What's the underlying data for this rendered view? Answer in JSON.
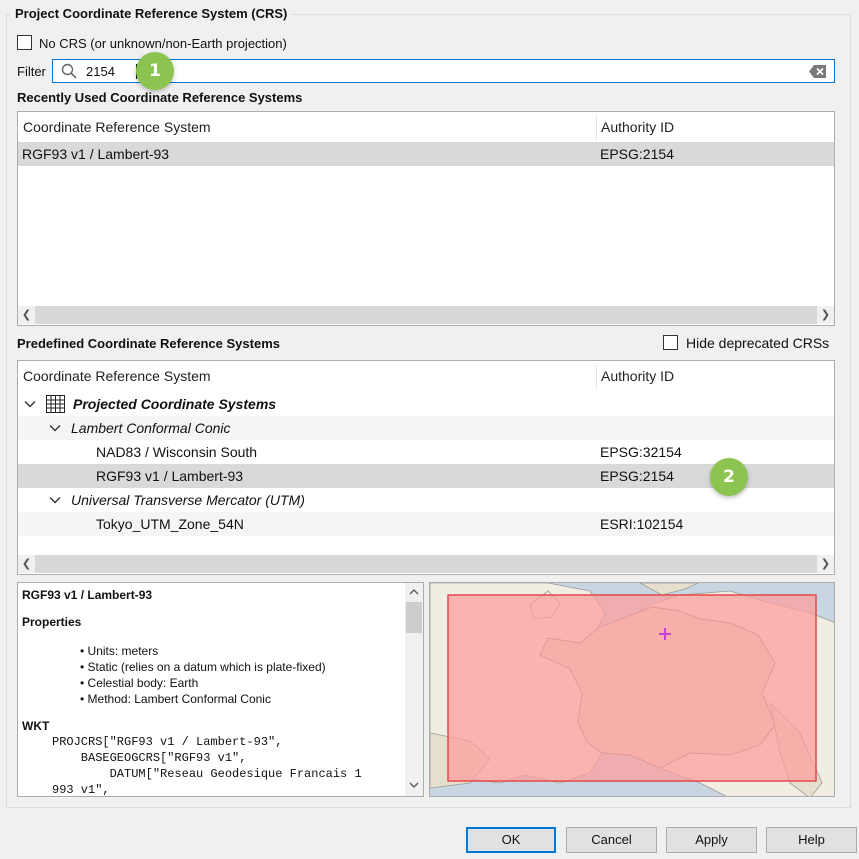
{
  "group": {
    "title": "Project Coordinate Reference System (CRS)"
  },
  "no_crs": {
    "label": "No CRS (or unknown/non-Earth projection)",
    "checked": false
  },
  "filter": {
    "label": "Filter",
    "value": "2154"
  },
  "recent": {
    "title": "Recently Used Coordinate Reference Systems",
    "columns": [
      "Coordinate Reference System",
      "Authority ID"
    ],
    "rows": [
      {
        "name": "RGF93 v1 / Lambert-93",
        "auth": "EPSG:2154",
        "selected": true
      }
    ]
  },
  "predefined": {
    "title": "Predefined Coordinate Reference Systems",
    "hide_deprecated": {
      "label": "Hide deprecated CRSs",
      "checked": false
    },
    "columns": [
      "Coordinate Reference System",
      "Authority ID"
    ],
    "group": "Projected Coordinate Systems",
    "subgroups": [
      {
        "name": "Lambert Conformal Conic",
        "items": [
          {
            "name": "NAD83 / Wisconsin South",
            "auth": "EPSG:32154"
          },
          {
            "name": "RGF93 v1 / Lambert-93",
            "auth": "EPSG:2154",
            "selected": true
          }
        ]
      },
      {
        "name": "Universal Transverse Mercator (UTM)",
        "items": [
          {
            "name": "Tokyo_UTM_Zone_54N",
            "auth": "ESRI:102154"
          }
        ]
      }
    ]
  },
  "info": {
    "title": "RGF93 v1 / Lambert-93",
    "properties_heading": "Properties",
    "properties": [
      "Units: meters",
      "Static (relies on a datum which is plate-fixed)",
      "Celestial body: Earth",
      "Method: Lambert Conformal Conic"
    ],
    "wkt_heading": "WKT",
    "wkt_lines": [
      "PROJCRS[\"RGF93 v1 / Lambert-93\",",
      "    BASEGEOGCRS[\"RGF93 v1\",",
      "        DATUM[\"Reseau Geodesique Francais 1",
      "993 v1\","
    ]
  },
  "badges": {
    "one": "1",
    "two": "2"
  },
  "buttons": {
    "ok": "OK",
    "cancel": "Cancel",
    "apply": "Apply",
    "help": "Help"
  },
  "colors": {
    "accent": "#0078d7",
    "badge": "#8dc451",
    "extent_fill": "#ff9c9c",
    "extent_border": "#e04a4a",
    "center_marker": "#c940d6"
  }
}
